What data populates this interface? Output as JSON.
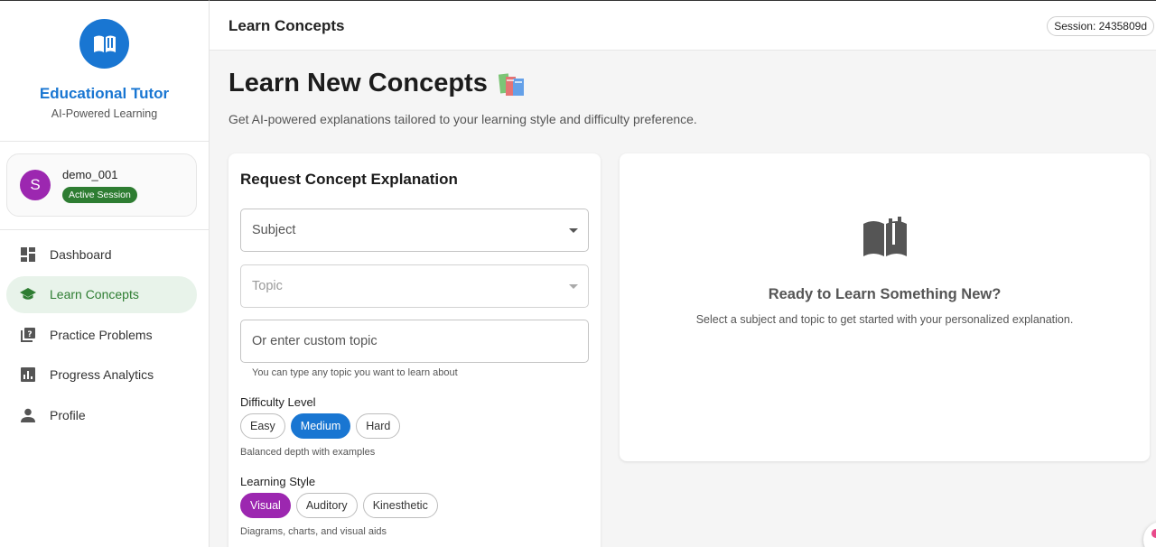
{
  "brand": {
    "title": "Educational Tutor",
    "subtitle": "AI-Powered Learning"
  },
  "user": {
    "initial": "S",
    "name": "demo_001",
    "badge": "Active Session"
  },
  "nav": [
    {
      "label": "Dashboard",
      "icon": "dashboard-icon",
      "active": false
    },
    {
      "label": "Learn Concepts",
      "icon": "graduation-cap-icon",
      "active": true
    },
    {
      "label": "Practice Problems",
      "icon": "quiz-icon",
      "active": false
    },
    {
      "label": "Progress Analytics",
      "icon": "analytics-icon",
      "active": false
    },
    {
      "label": "Profile",
      "icon": "person-icon",
      "active": false
    }
  ],
  "header": {
    "title": "Learn Concepts",
    "session": "Session: 2435809d"
  },
  "main": {
    "title": "Learn New Concepts",
    "title_emoji": "📚",
    "subtitle": "Get AI-powered explanations tailored to your learning style and difficulty preference."
  },
  "form": {
    "title": "Request Concept Explanation",
    "subject_placeholder": "Subject",
    "topic_placeholder": "Topic",
    "custom_placeholder": "Or enter custom topic",
    "custom_helper": "You can type any topic you want to learn about",
    "difficulty": {
      "label": "Difficulty Level",
      "options": [
        "Easy",
        "Medium",
        "Hard"
      ],
      "selected": "Medium",
      "description": "Balanced depth with examples"
    },
    "style": {
      "label": "Learning Style",
      "options": [
        "Visual",
        "Auditory",
        "Kinesthetic"
      ],
      "selected": "Visual",
      "description": "Diagrams, charts, and visual aids"
    }
  },
  "empty_state": {
    "title": "Ready to Learn Something New?",
    "subtitle": "Select a subject and topic to get started with your personalized explanation."
  },
  "colors": {
    "primary": "#1976d2",
    "success": "#2e7d32",
    "accent": "#9c27b0"
  }
}
